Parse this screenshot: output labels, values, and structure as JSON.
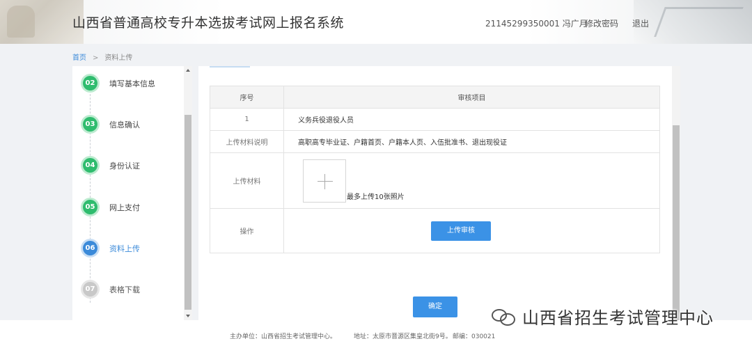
{
  "header": {
    "title": "山西省普通高校专升本选拔考试网上报名系统",
    "user": "21145299350001  冯广月",
    "change_password": "修改密码",
    "logout": "退出"
  },
  "breadcrumb": {
    "home": "首页",
    "separator": ">",
    "current": "资料上传"
  },
  "steps": [
    {
      "num": "02",
      "label": "填写基本信息",
      "status": "done"
    },
    {
      "num": "03",
      "label": "信息确认",
      "status": "done"
    },
    {
      "num": "04",
      "label": "身份认证",
      "status": "done"
    },
    {
      "num": "05",
      "label": "网上支付",
      "status": "done"
    },
    {
      "num": "06",
      "label": "资料上传",
      "status": "active"
    },
    {
      "num": "07",
      "label": "表格下载",
      "status": "todo"
    }
  ],
  "table": {
    "col_index": "序号",
    "col_item": "审核项目",
    "row_index_value": "1",
    "row_item_value": "义务兵役退役人员",
    "desc_label": "上传材料说明",
    "desc_value": "高职高专毕业证、户籍首页、户籍本人页、入伍批准书、退出现役证",
    "upload_label": "上传材料",
    "upload_hint": "最多上传10张照片",
    "op_label": "操作",
    "upload_button": "上传审核"
  },
  "confirm_button": "确定",
  "footer": {
    "host": "主办单位：山西省招生考试管理中心。",
    "address": "地址：太原市晋源区集皇北街9号。",
    "postcode": "邮编：030021"
  },
  "watermark": "山西省招生考试管理中心",
  "colors": {
    "accent": "#3b92e6",
    "done_step": "#2fbc6e",
    "active_step": "#3b8ad9",
    "todo_step": "#c8c8c8"
  }
}
